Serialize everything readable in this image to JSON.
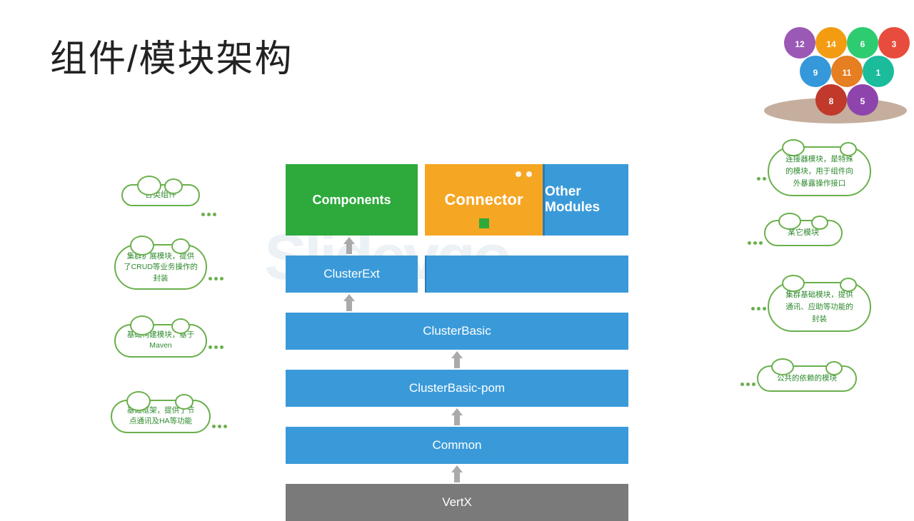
{
  "title": "组件/模块架构",
  "diagram": {
    "components_label": "Components",
    "connector_label": "Connector",
    "other_modules_label": "Other Modules",
    "layers": [
      {
        "id": "clusterext",
        "label": "ClusterExt",
        "color": "#3a9ad9"
      },
      {
        "id": "clusterbasic",
        "label": "ClusterBasic",
        "color": "#3a9ad9"
      },
      {
        "id": "pom",
        "label": "ClusterBasic-pom",
        "color": "#3a9ad9"
      },
      {
        "id": "common",
        "label": "Common",
        "color": "#3a9ad9"
      },
      {
        "id": "vertx",
        "label": "VertX",
        "color": "#7a7a7a"
      }
    ]
  },
  "left_clouds": [
    {
      "id": "c1",
      "text": "各类组件"
    },
    {
      "id": "c2",
      "text": "集群扩展模块，提供\n了CRUD等业务操作的\n封装"
    },
    {
      "id": "c3",
      "text": "基础构建模块，基于\nMaven"
    },
    {
      "id": "c4",
      "text": "基础框架，提供了节\n点通讯及HA等功能"
    }
  ],
  "right_clouds": [
    {
      "id": "r1",
      "text": "连接器模块，是特殊\n的模块，用于组件向\n外暴露操作接口"
    },
    {
      "id": "r2",
      "text": "某它模块"
    },
    {
      "id": "r3",
      "text": "集群基础模块，提供\n通讯、应助等功能的\n封装"
    },
    {
      "id": "r4",
      "text": "公共的依赖的模块"
    }
  ],
  "watermark": "Slidevgo"
}
